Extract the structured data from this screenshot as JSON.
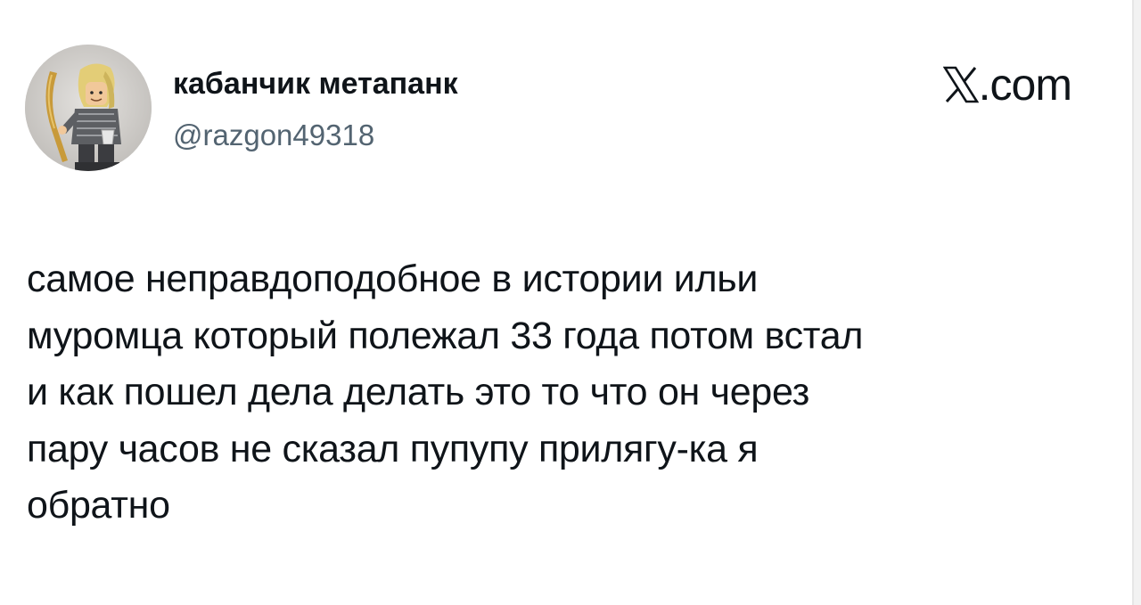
{
  "author": {
    "display_name": "кабанчик метапанк",
    "handle": "@razgon49318",
    "avatar_icon": "user-avatar-figurine-icon"
  },
  "brand": {
    "logo_icon": "x-logo-icon",
    "text": ".com"
  },
  "tweet": {
    "text": "самое неправдоподобное в истории ильи\nмуромца который полежал 33 года потом встал\nи как пошел дела делать это то что он через\nпару часов не сказал пупупу прилягу-ка я\nобратно"
  },
  "colors": {
    "text_primary": "#0f1419",
    "text_secondary": "#536471",
    "background": "#ffffff"
  }
}
